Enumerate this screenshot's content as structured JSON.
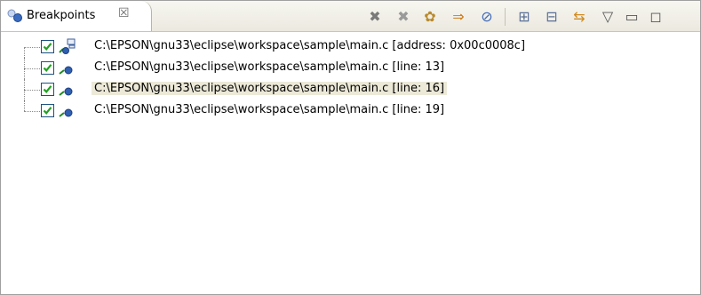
{
  "view": {
    "tab_title": "Breakpoints",
    "close_glyph": "☒"
  },
  "toolbar": {
    "buttons": [
      {
        "name": "remove-breakpoint-button",
        "icon": "remove-icon",
        "glyph": "✖",
        "color": "#7a7a7a"
      },
      {
        "name": "remove-all-breakpoints-button",
        "icon": "remove-all-icon",
        "glyph": "✖",
        "color": "#9a9a9a"
      },
      {
        "name": "show-supported-breakpoints-button",
        "icon": "gears-icon",
        "glyph": "✿",
        "color": "#b88a2e"
      },
      {
        "name": "go-to-file-button",
        "icon": "go-to-file-icon",
        "glyph": "⇒",
        "color": "#d07d1a"
      },
      {
        "name": "skip-all-breakpoints-button",
        "icon": "skip-icon",
        "glyph": "⊘",
        "color": "#3d68b8"
      },
      {
        "name": "expand-all-button",
        "icon": "expand-all-icon",
        "glyph": "⊞",
        "color": "#5a6f99"
      },
      {
        "name": "collapse-all-button",
        "icon": "collapse-all-icon",
        "glyph": "⊟",
        "color": "#5a6f99"
      },
      {
        "name": "link-with-debug-view-button",
        "icon": "link-icon",
        "glyph": "⇆",
        "color": "#d08a20"
      },
      {
        "name": "view-menu-button",
        "icon": "view-menu-icon",
        "glyph": "▽",
        "color": "#555555"
      },
      {
        "name": "minimize-button",
        "icon": "minimize-icon",
        "glyph": "▭",
        "color": "#555555"
      },
      {
        "name": "maximize-button",
        "icon": "maximize-icon",
        "glyph": "◻",
        "color": "#555555"
      }
    ]
  },
  "breakpoints": [
    {
      "label": "C:\\EPSON\\gnu33\\eclipse\\workspace\\sample\\main.c [address: 0x00c0008c]",
      "checked": true,
      "kind": "address",
      "selected": false
    },
    {
      "label": "C:\\EPSON\\gnu33\\eclipse\\workspace\\sample\\main.c [line: 13]",
      "checked": true,
      "kind": "line",
      "selected": false
    },
    {
      "label": "C:\\EPSON\\gnu33\\eclipse\\workspace\\sample\\main.c [line: 16]",
      "checked": true,
      "kind": "line",
      "selected": true
    },
    {
      "label": "C:\\EPSON\\gnu33\\eclipse\\workspace\\sample\\main.c [line: 19]",
      "checked": true,
      "kind": "line",
      "selected": false
    }
  ],
  "colors": {
    "check": "#21a121",
    "breakpoint_blue": "#2f5fb0",
    "selection": "#ece9d8"
  }
}
